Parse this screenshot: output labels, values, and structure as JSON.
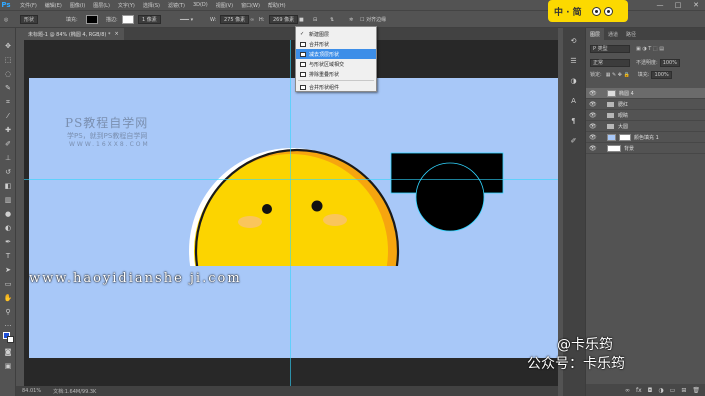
{
  "app": {
    "logo": "Ps"
  },
  "menu": [
    "文件(F)",
    "编辑(E)",
    "图像(I)",
    "图层(L)",
    "文字(Y)",
    "选择(S)",
    "滤镜(T)",
    "3D(D)",
    "视图(V)",
    "窗口(W)",
    "帮助(H)"
  ],
  "window_controls": {
    "minimize": "—",
    "maximize": "□",
    "close": "✕"
  },
  "badge": {
    "text": "中 · 简"
  },
  "options": {
    "mode": "形状",
    "fill_label": "填充:",
    "stroke_label": "描边:",
    "stroke_size": "1 像素",
    "w_label": "W:",
    "w_value": "275 像素",
    "h_label": "H:",
    "h_value": "269 像素",
    "align_edges": "对齐边缘"
  },
  "path_ops_menu": {
    "items": [
      {
        "label": "新建图层",
        "checked": true
      },
      {
        "label": "合并形状"
      },
      {
        "label": "减去顶层形状",
        "selected": true
      },
      {
        "label": "与形状区域相交"
      },
      {
        "label": "排除重叠形状"
      },
      {
        "label": "合并形状组件"
      }
    ]
  },
  "document": {
    "tab_title": "未标题-1 @ 84% (椭圆 4, RGB/8) *",
    "close": "×"
  },
  "watermark": {
    "title": "PS教程自学网",
    "subtitle": "学PS，就到PS教程自学网",
    "url": "WWW.16XX8.COM"
  },
  "url_overlay": "www.haoyidianshe ji.com",
  "status": {
    "zoom": "84.01%",
    "doc": "文档:1.64M/99.3K"
  },
  "layers_panel": {
    "tabs": [
      "图层",
      "通道",
      "路径"
    ],
    "filter_label": "P 类型",
    "blend_mode": "正常",
    "opacity_label": "不透明度:",
    "opacity_value": "100%",
    "lock_label": "锁定:",
    "fill_label": "填充:",
    "fill_value": "100%",
    "layers": [
      {
        "name": "椭圆 4",
        "kind": "shape",
        "selected": true
      },
      {
        "name": "腮红",
        "kind": "group"
      },
      {
        "name": "眼睛",
        "kind": "group"
      },
      {
        "name": "大圆",
        "kind": "group"
      },
      {
        "name": "颜色填充 1",
        "kind": "fill"
      },
      {
        "name": "背景",
        "kind": "background"
      }
    ],
    "footer_icons": [
      "link-icon",
      "fx-icon",
      "mask-icon",
      "adjust-icon",
      "folder-icon",
      "new-layer-icon",
      "trash-icon"
    ]
  },
  "credit": {
    "line1": "@卡乐筠",
    "line2": "公众号：卡乐筠"
  },
  "colors": {
    "canvas": "#a8c8f8",
    "sun_yellow": "#fcd400",
    "sun_orange": "#f6a50f",
    "fg": "#1e4fd8"
  }
}
